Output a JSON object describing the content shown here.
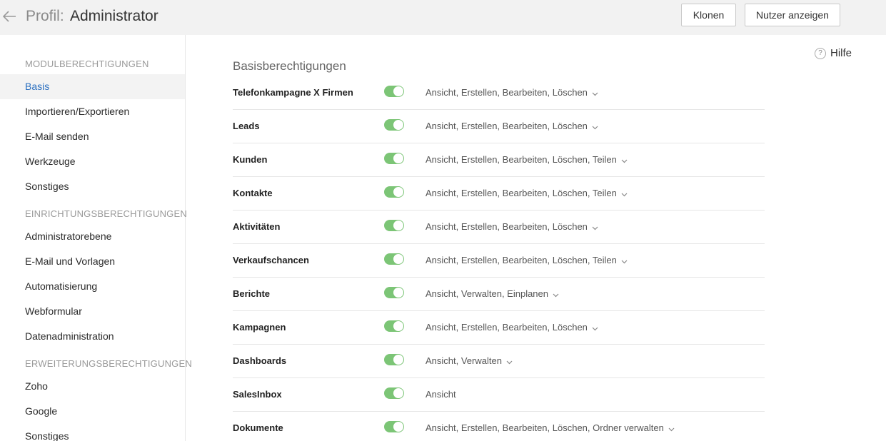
{
  "header": {
    "title_prefix": "Profil:",
    "title_name": "Administrator",
    "clone_label": "Klonen",
    "show_users_label": "Nutzer anzeigen",
    "back_icon": "arrow-left-icon"
  },
  "sidebar": {
    "sections": [
      {
        "title": "MODULBERECHTIGUNGEN",
        "items": [
          "Basis",
          "Importieren/Exportieren",
          "E-Mail senden",
          "Werkzeuge",
          "Sonstiges"
        ]
      },
      {
        "title": "EINRICHTUNGSBERECHTIGUNGEN",
        "items": [
          "Administratorebene",
          "E-Mail und Vorlagen",
          "Automatisierung",
          "Webformular",
          "Datenadministration"
        ]
      },
      {
        "title": "ERWEITERUNGSBERECHTIGUNGEN",
        "items": [
          "Zoho",
          "Google",
          "Sonstiges"
        ]
      }
    ],
    "active_item": "Basis"
  },
  "main": {
    "title": "Basisberechtigungen",
    "help_label": "Hilfe",
    "help_icon_glyph": "?",
    "permissions": [
      {
        "name": "Telefonkampagne X Firmen",
        "enabled": true,
        "value": "Ansicht, Erstellen, Bearbeiten, Löschen",
        "has_dropdown": true
      },
      {
        "name": "Leads",
        "enabled": true,
        "value": "Ansicht, Erstellen, Bearbeiten, Löschen",
        "has_dropdown": true
      },
      {
        "name": "Kunden",
        "enabled": true,
        "value": "Ansicht, Erstellen, Bearbeiten, Löschen, Teilen",
        "has_dropdown": true
      },
      {
        "name": "Kontakte",
        "enabled": true,
        "value": "Ansicht, Erstellen, Bearbeiten, Löschen, Teilen",
        "has_dropdown": true
      },
      {
        "name": "Aktivitäten",
        "enabled": true,
        "value": "Ansicht, Erstellen, Bearbeiten, Löschen",
        "has_dropdown": true
      },
      {
        "name": "Verkaufschancen",
        "enabled": true,
        "value": "Ansicht, Erstellen, Bearbeiten, Löschen, Teilen",
        "has_dropdown": true
      },
      {
        "name": "Berichte",
        "enabled": true,
        "value": "Ansicht, Verwalten, Einplanen",
        "has_dropdown": true
      },
      {
        "name": "Kampagnen",
        "enabled": true,
        "value": "Ansicht, Erstellen, Bearbeiten, Löschen",
        "has_dropdown": true
      },
      {
        "name": "Dashboards",
        "enabled": true,
        "value": "Ansicht, Verwalten",
        "has_dropdown": true
      },
      {
        "name": "SalesInbox",
        "enabled": true,
        "value": "Ansicht",
        "has_dropdown": false
      },
      {
        "name": "Dokumente",
        "enabled": true,
        "value": "Ansicht, Erstellen, Bearbeiten, Löschen, Ordner verwalten",
        "has_dropdown": true
      }
    ]
  },
  "colors": {
    "toggle_on": "#7cc576",
    "active_link": "#2a6fc0",
    "topbar_bg": "#f2f2f2"
  }
}
